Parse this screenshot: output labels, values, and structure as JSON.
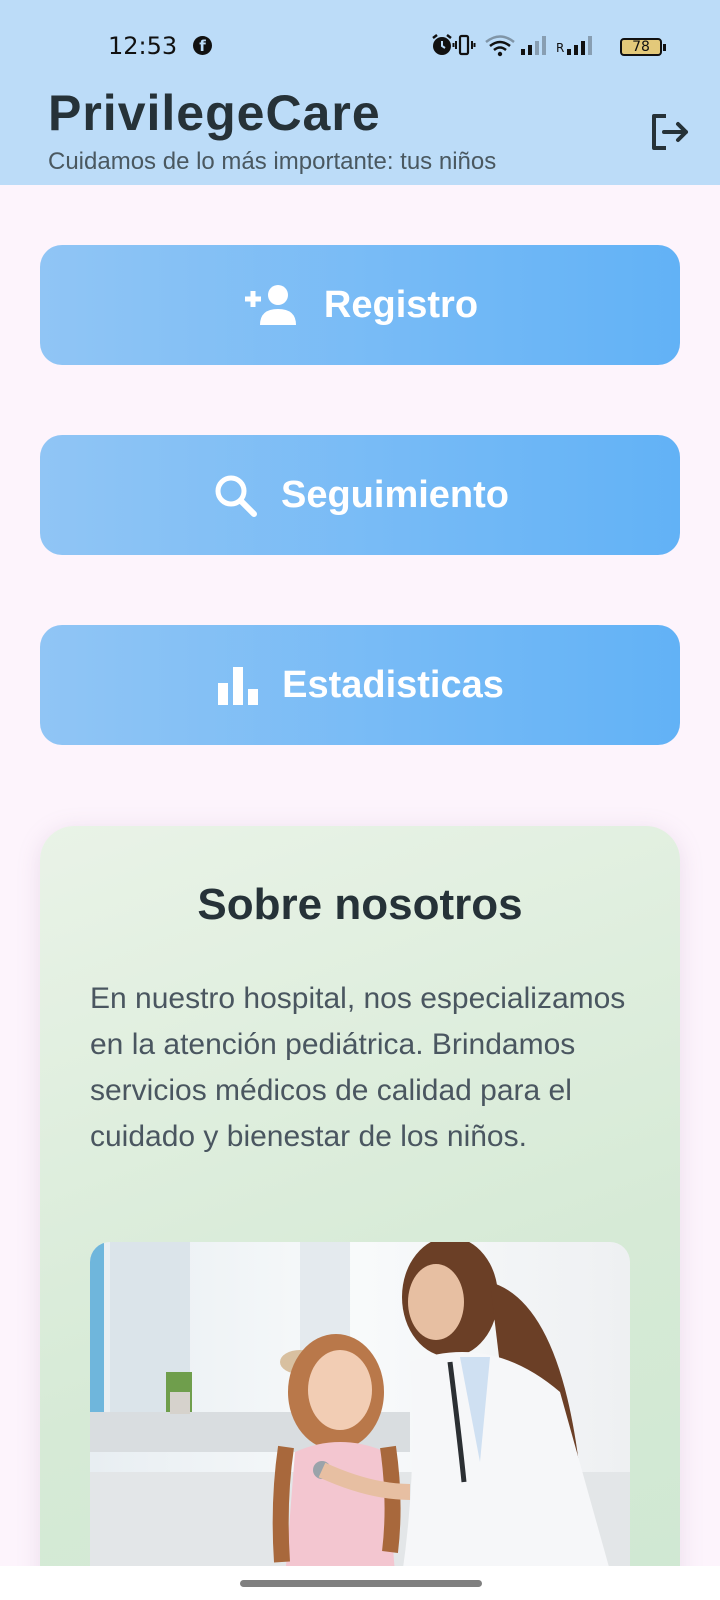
{
  "status_bar": {
    "time": "12:53",
    "battery": "78",
    "network_label": "R"
  },
  "header": {
    "title": "PrivilegeCare",
    "subtitle": "Cuidamos de lo más importante: tus niños",
    "logout_icon": "logout-icon"
  },
  "actions": [
    {
      "label": "Registro",
      "icon": "person-add-icon"
    },
    {
      "label": "Seguimiento",
      "icon": "search-icon"
    },
    {
      "label": "Estadisticas",
      "icon": "bar-chart-icon"
    }
  ],
  "about": {
    "title": "Sobre nosotros",
    "text": "En nuestro hospital, nos especializamos en la atención pediátrica. Brindamos servicios médicos de calidad para el cuidado y bienestar de los niños.",
    "image_alt": "doctor-examining-child-photo"
  },
  "colors": {
    "header_bg": "#bcdcf8",
    "button_gradient_start": "#90c5f5",
    "button_gradient_end": "#62b2f6",
    "card_bg": "#d6ead6",
    "page_bg": "#fdf4fc"
  }
}
